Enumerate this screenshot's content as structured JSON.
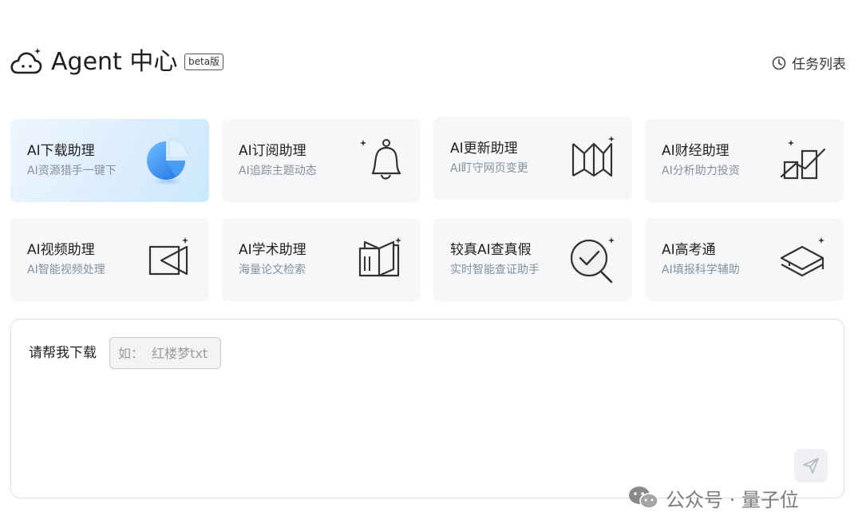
{
  "header": {
    "title": "Agent 中心",
    "badge": "beta版",
    "task_list_label": "任务列表"
  },
  "cards": [
    {
      "title": "AI下载助理",
      "desc": "AI资源猎手一键下",
      "icon": "download-pie-icon",
      "active": true
    },
    {
      "title": "AI订阅助理",
      "desc": "AI追踪主题动态",
      "icon": "bell-icon",
      "active": false
    },
    {
      "title": "AI更新助理",
      "desc": "AI盯守网页变更",
      "icon": "webpage-update-icon",
      "active": false
    },
    {
      "title": "AI财经助理",
      "desc": "AI分析助力投资",
      "icon": "finance-chart-icon",
      "active": false
    },
    {
      "title": "AI视频助理",
      "desc": "AI智能视频处理",
      "icon": "video-camera-icon",
      "active": false
    },
    {
      "title": "AI学术助理",
      "desc": "海量论文检索",
      "icon": "open-book-icon",
      "active": false
    },
    {
      "title": "较真AI查真假",
      "desc": "实时智能查证助手",
      "icon": "magnifier-check-icon",
      "active": false
    },
    {
      "title": "AI高考通",
      "desc": "AI填报科学辅助",
      "icon": "graduation-cap-icon",
      "active": false
    }
  ],
  "input": {
    "label": "请帮我下载",
    "placeholder": "如：  红楼梦txt"
  },
  "watermark": {
    "text": "公众号 · 量子位"
  },
  "colors": {
    "accent_blue": "#3b8ff0",
    "card_bg": "#f6f7f9",
    "active_card_bg": "#d9ecfd"
  }
}
